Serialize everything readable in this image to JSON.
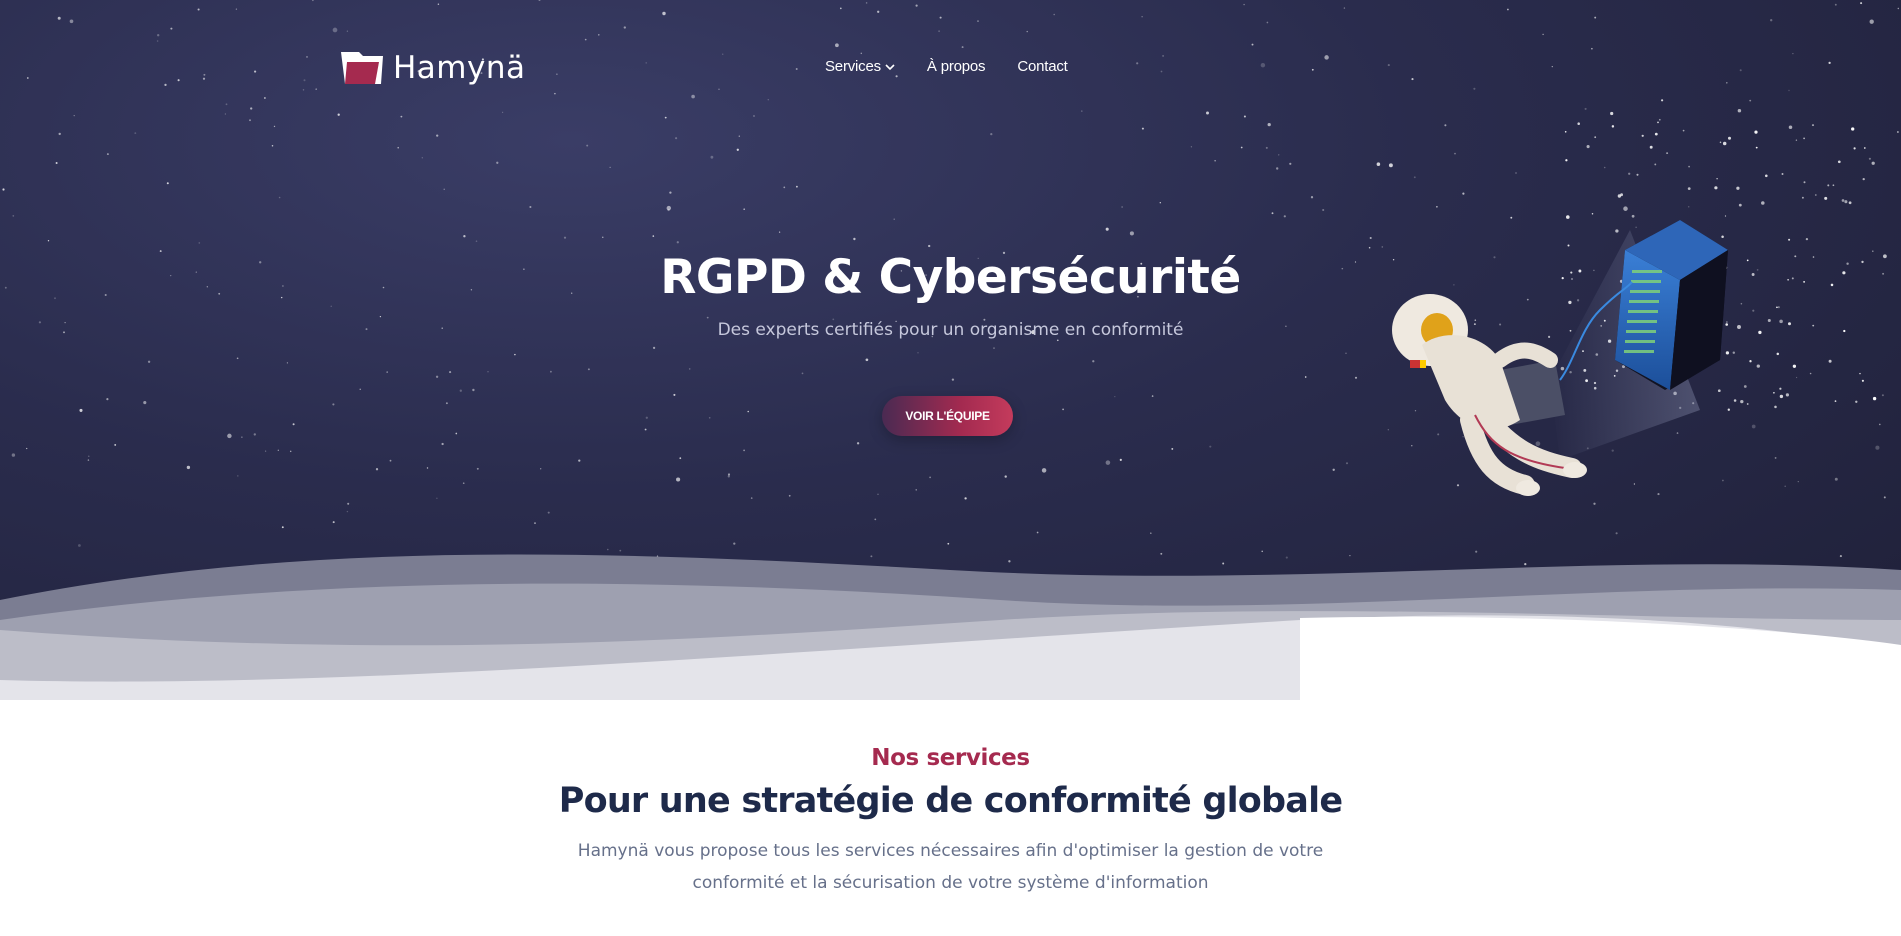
{
  "brand": {
    "name": "Hamynä",
    "accent": "#a52a4f"
  },
  "nav": {
    "items": [
      {
        "label": "Services",
        "has_dropdown": true
      },
      {
        "label": "À propos"
      },
      {
        "label": "Contact"
      }
    ]
  },
  "hero": {
    "title": "RGPD & Cybersécurité",
    "subtitle": "Des experts certifiés pour un organisme en conformité",
    "cta_label": "VOIR L'ÉQUIPE"
  },
  "services": {
    "eyebrow": "Nos services",
    "title": "Pour une stratégie de conformité globale",
    "description": "Hamynä vous propose tous les services nécessaires afin d'optimiser la gestion de votre conformité et la sécurisation de votre système d'information"
  },
  "colors": {
    "hero_bg": "#2a2c4d",
    "cta_gradient_start": "#4a2a52",
    "cta_gradient_end": "#c43b5c",
    "heading_dark": "#1e2a4a",
    "body_text": "#66708a"
  },
  "icons": {
    "logo_mark": "folder-logo-icon",
    "dropdown": "chevron-down-icon",
    "illustration": "astronaut-server-illustration"
  }
}
